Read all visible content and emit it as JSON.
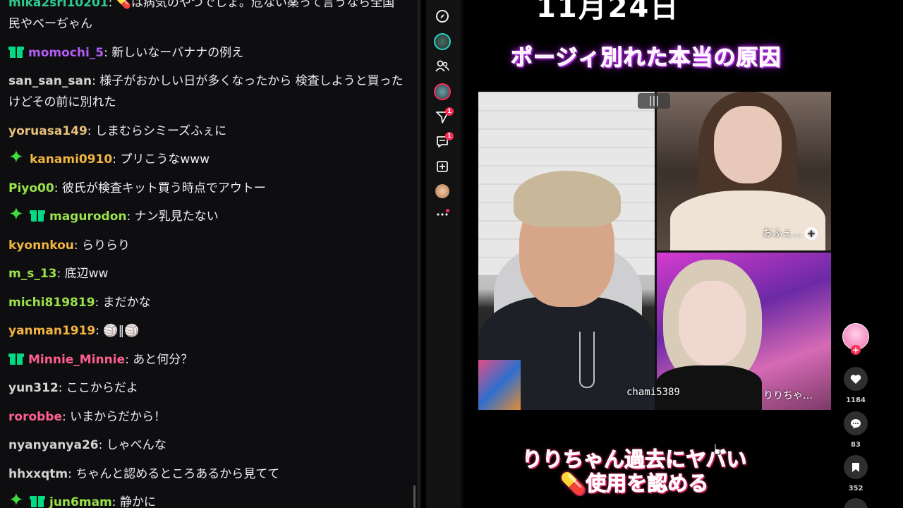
{
  "chat": {
    "messages": [
      {
        "badges": [],
        "user": "mika2sri10201",
        "color": "#2ecb8f",
        "text": "💊は病気のやつでしょ。危ない薬って言うなら全国民やベーぢゃん"
      },
      {
        "badges": [
          "gift"
        ],
        "user": "momochi_5",
        "color": "#b45cf5",
        "text": "新しいなーバナナの例え"
      },
      {
        "badges": [],
        "user": "san_san_san",
        "color": "#d3d3d3",
        "text": "様子がおかしい日が多くなったから 検査しようと買ったけどその前に別れた"
      },
      {
        "badges": [],
        "user": "yoruasa149",
        "color": "#e6c07a",
        "text": "しまむらシミーズふぇに"
      },
      {
        "badges": [
          "star"
        ],
        "user": "kanami0910",
        "color": "#f2b542",
        "text": "プリこうなwww"
      },
      {
        "badges": [],
        "user": "Piyo00",
        "color": "#9be24a",
        "text": "彼氏が検査キット買う時点でアウトー"
      },
      {
        "badges": [
          "star",
          "gift"
        ],
        "user": "magurodon",
        "color": "#9be24a",
        "text": "ナン乳見たない"
      },
      {
        "badges": [],
        "user": "kyonnkou",
        "color": "#f2b542",
        "text": "らりらり"
      },
      {
        "badges": [],
        "user": "m_s_13",
        "color": "#9be24a",
        "text": "底辺ww"
      },
      {
        "badges": [],
        "user": "michi819819",
        "color": "#9be24a",
        "text": "まだかな"
      },
      {
        "badges": [],
        "user": "yanman1919",
        "color": "#f2b542",
        "text": "🏐‖🏐"
      },
      {
        "badges": [
          "gift"
        ],
        "user": "Minnie_Minnie",
        "color": "#ff5f8f",
        "text": "あと何分？"
      },
      {
        "badges": [],
        "user": "yun312",
        "color": "#d3d3d3",
        "text": "ここからだよ"
      },
      {
        "badges": [],
        "user": "rorobbe",
        "color": "#ff5f8f",
        "text": "いまからだから！"
      },
      {
        "badges": [],
        "user": "nyanyanya26",
        "color": "#d3d3d3",
        "text": "しゃべんな"
      },
      {
        "badges": [],
        "user": "hhxxqtm",
        "color": "#d3d3d3",
        "text": "ちゃんと認めるところあるから見てて"
      },
      {
        "badges": [
          "star",
          "gift"
        ],
        "user": "jun6mam",
        "color": "#9be24a",
        "text": "静かに"
      }
    ]
  },
  "tiktok": {
    "date_title": "11月24日",
    "caption_top": "ポージィ別れた本当の原因",
    "caption_bottom_line1": "りりちゃん過去にヤバい",
    "caption_bottom_line2": "💊使用を認める",
    "video": {
      "label_top_right": "おふぇ…",
      "label_bottom_left": "chami5389",
      "label_bottom_right": "りりちゃ…",
      "bars_icon": "|||"
    },
    "actions": {
      "like_count": "1184",
      "comment_count": "83",
      "bookmark_count": "352"
    },
    "rail_icons": [
      "compass-icon",
      "avatar-icon",
      "friends-icon",
      "avatar-icon",
      "send-icon",
      "inbox-icon",
      "upload-icon",
      "avatar-icon",
      "more-icon"
    ],
    "rail_badges": {
      "send": "1",
      "inbox": "1"
    }
  },
  "colors": {
    "chat_bg": "#0e0e10",
    "accent_pink": "#fe2c55",
    "caption_top": "#f3b6ff",
    "caption_bottom": "#ffb3c8"
  }
}
